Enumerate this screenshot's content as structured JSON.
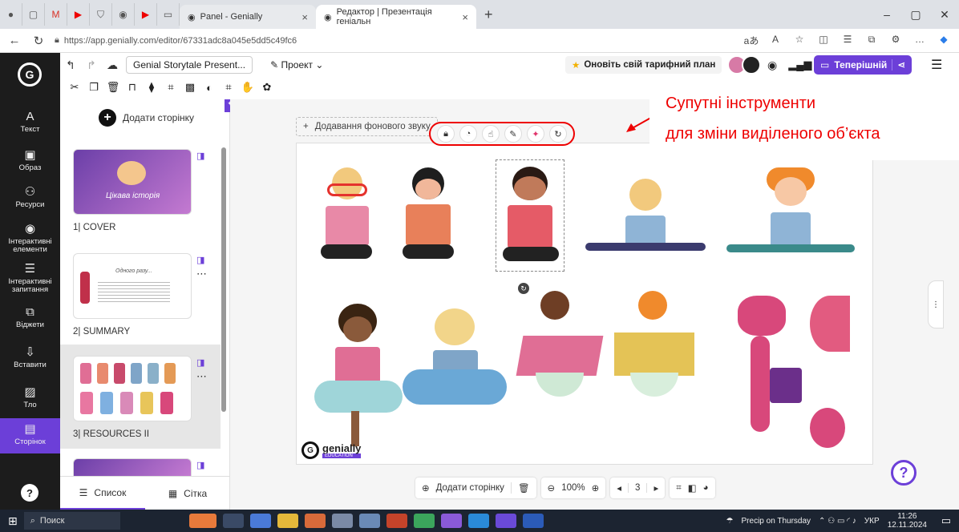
{
  "browser": {
    "tabs": [
      {
        "label": "Panel - Genially",
        "active": false
      },
      {
        "label": "Редактор | Презентація геніальн",
        "active": true
      }
    ],
    "new_tab_icon": "plus-icon",
    "url": "https://app.genially.com/editor/67331adc8a045e5dd5c49fc6"
  },
  "topbar": {
    "project_name": "Genial Storytale Present...",
    "project_menu": "Проект",
    "upgrade": "Оновіть свій тарифний план",
    "present": "Теперішній"
  },
  "sidebar": {
    "items": [
      {
        "label": "Текст",
        "icon": "text-icon",
        "glyph": "A"
      },
      {
        "label": "Образ",
        "icon": "image-icon",
        "glyph": "▣"
      },
      {
        "label": "Ресурси",
        "icon": "resources-icon",
        "glyph": "⚇"
      },
      {
        "label": "Інтерактивні елементи",
        "icon": "interactive-icon",
        "glyph": "◉"
      },
      {
        "label": "Інтерактивні запитання",
        "icon": "questions-icon",
        "glyph": "☰"
      },
      {
        "label": "Віджети",
        "icon": "widgets-icon",
        "glyph": "⧉"
      },
      {
        "label": "Вставити",
        "icon": "insert-icon",
        "glyph": "⇩"
      },
      {
        "label": "Тло",
        "icon": "background-icon",
        "glyph": "▨"
      },
      {
        "label": "Сторінок",
        "icon": "pages-icon",
        "glyph": "▤"
      }
    ],
    "help": "?"
  },
  "pages_panel": {
    "add_page": "Додати сторінку",
    "pages": [
      {
        "label": "1| COVER",
        "thumb_title": "Цікава історія"
      },
      {
        "label": "2| SUMMARY",
        "thumb_title": "Одного разу..."
      },
      {
        "label": "3| RESOURCES II",
        "thumb_title": ""
      }
    ],
    "view_list": "Список",
    "view_grid": "Сітка"
  },
  "canvas": {
    "sound_button": "Додавання фонового звуку",
    "callout_line1": "Супутні інструменти",
    "callout_line2": "для зміни виділеного об’єкта",
    "watermark": "genially",
    "watermark_sub": "EDUCATION",
    "add_page": "Додати сторінку",
    "zoom": "100%",
    "page_number": "3"
  },
  "taskbar": {
    "search": "Поиск",
    "weather": "Precip on Thursday",
    "lang": "УКР",
    "time": "11:26",
    "date": "12.11.2024"
  },
  "colors": {
    "accent": "#6c3fd8",
    "sidebar": "#1c1c1c",
    "callout_red": "#e00000"
  }
}
